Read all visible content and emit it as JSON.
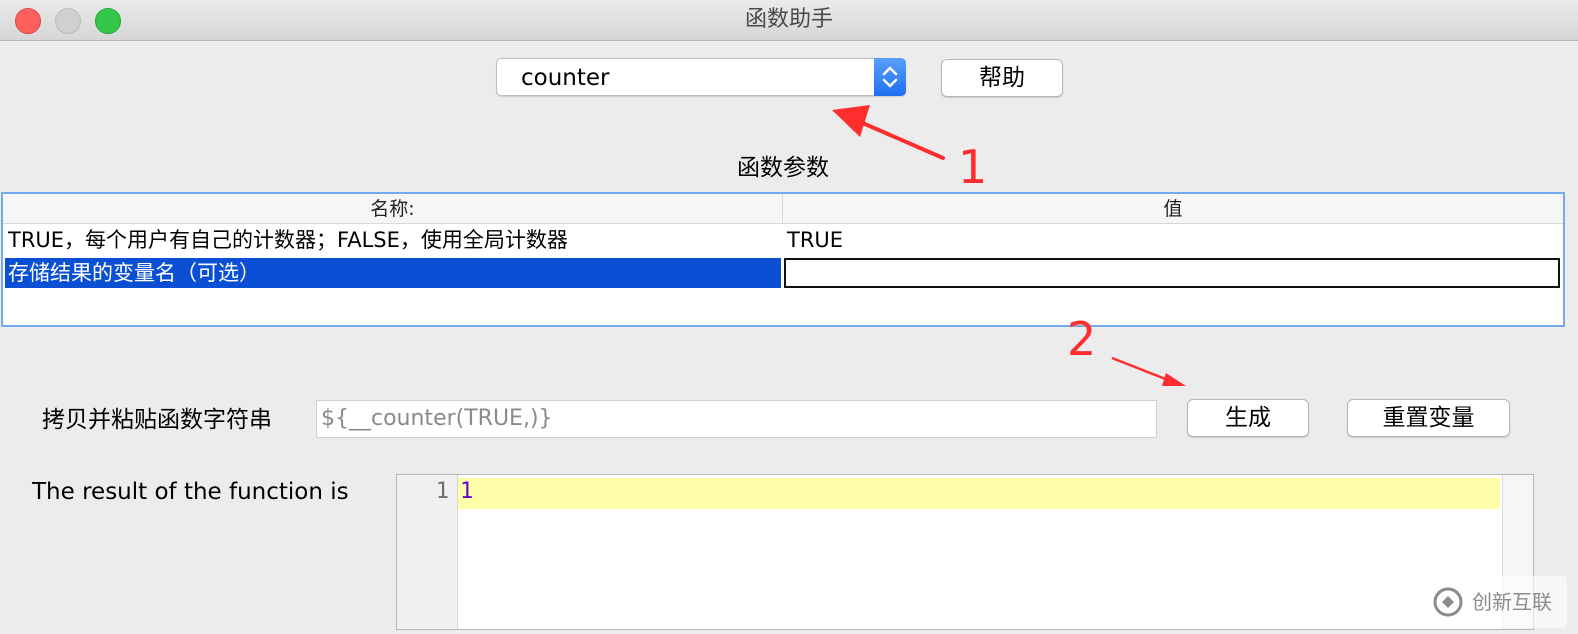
{
  "window": {
    "title": "函数助手"
  },
  "function_select": {
    "value": "counter"
  },
  "buttons": {
    "help": "帮助",
    "generate": "生成",
    "reset": "重置变量"
  },
  "params": {
    "title": "函数参数",
    "columns": [
      "名称:",
      "值"
    ],
    "rows": [
      {
        "name": "TRUE，每个用户有自己的计数器；FALSE，使用全局计数器",
        "value": "TRUE"
      },
      {
        "name": "存储结果的变量名（可选）",
        "value": ""
      }
    ]
  },
  "copy_label": "拷贝并粘贴函数字符串",
  "function_string": "${__counter(TRUE,)}",
  "result": {
    "label": "The result of the function is",
    "line_number": "1",
    "value": "1"
  },
  "annotations": [
    "1",
    "2"
  ],
  "watermark": {
    "text": "创新互联"
  },
  "colors": {
    "selection": "#0b50d4",
    "accent": "#1e6ff0",
    "annotation": "#ff2d2d"
  }
}
